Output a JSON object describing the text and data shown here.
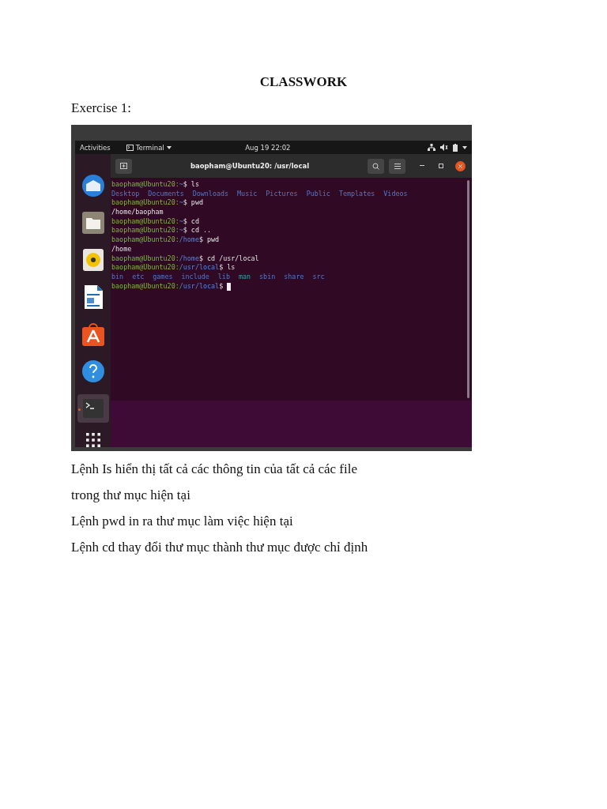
{
  "title": "CLASSWORK",
  "exercise": "Exercise 1:",
  "screenshot": {
    "top_bar": {
      "activities": "Activities",
      "app": "Terminal",
      "clock": "Aug 19  22:02"
    },
    "dock": [
      {
        "kind": "mail",
        "running": false
      },
      {
        "kind": "files",
        "running": false
      },
      {
        "kind": "music",
        "running": false
      },
      {
        "kind": "writer",
        "running": false
      },
      {
        "kind": "store",
        "running": false
      },
      {
        "kind": "help",
        "running": false
      },
      {
        "kind": "terminal",
        "running": true
      }
    ],
    "terminal": {
      "title": "baopham@Ubuntu20: /usr/local",
      "lines": [
        {
          "kind": "prompt",
          "user": "baopham@Ubuntu20:",
          "path": "~",
          "command": "$ ls"
        },
        {
          "kind": "listing",
          "items": [
            {
              "text": "Desktop",
              "kind": "dir"
            },
            {
              "text": "Documents",
              "kind": "dir"
            },
            {
              "text": "Downloads",
              "kind": "dir"
            },
            {
              "text": "Music",
              "kind": "dir"
            },
            {
              "text": "Pictures",
              "kind": "dir"
            },
            {
              "text": "Public",
              "kind": "dir"
            },
            {
              "text": "Templates",
              "kind": "dir"
            },
            {
              "text": "Videos",
              "kind": "dir"
            }
          ]
        },
        {
          "kind": "prompt",
          "user": "baopham@Ubuntu20:",
          "path": "~",
          "command": "$ pwd"
        },
        {
          "kind": "output",
          "text": "/home/baopham"
        },
        {
          "kind": "prompt",
          "user": "baopham@Ubuntu20:",
          "path": "~",
          "command": "$ cd"
        },
        {
          "kind": "prompt",
          "user": "baopham@Ubuntu20:",
          "path": "~",
          "command": "$ cd .."
        },
        {
          "kind": "prompt",
          "user": "baopham@Ubuntu20:",
          "path": "/home",
          "command": "$ pwd"
        },
        {
          "kind": "output",
          "text": "/home"
        },
        {
          "kind": "prompt",
          "user": "baopham@Ubuntu20:",
          "path": "/home",
          "command": "$ cd /usr/local"
        },
        {
          "kind": "prompt",
          "user": "baopham@Ubuntu20:",
          "path": "/usr/local",
          "command": "$ ls"
        },
        {
          "kind": "listing",
          "items": [
            {
              "text": "bin",
              "kind": "dir"
            },
            {
              "text": "etc",
              "kind": "dir"
            },
            {
              "text": "games",
              "kind": "dir"
            },
            {
              "text": "include",
              "kind": "dir"
            },
            {
              "text": "lib",
              "kind": "dir"
            },
            {
              "text": "man",
              "kind": "link"
            },
            {
              "text": "sbin",
              "kind": "dir"
            },
            {
              "text": "share",
              "kind": "dir"
            },
            {
              "text": "src",
              "kind": "dir"
            }
          ]
        },
        {
          "kind": "prompt",
          "user": "baopham@Ubuntu20:",
          "path": "/usr/local",
          "command": "$ ",
          "cursor": true
        }
      ]
    }
  },
  "lines": [
    "Lệnh Is hiển thị tất cả các thông tin của tất cả các file",
    "trong thư mục hiện tại",
    "Lệnh pwd in ra thư mục làm việc hiện tại",
    "Lệnh cd thay đổi thư mục thành thư mục được chỉ định"
  ]
}
